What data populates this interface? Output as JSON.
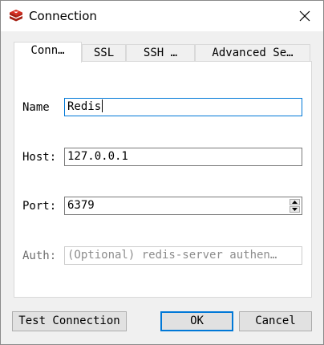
{
  "window": {
    "title": "Connection",
    "icon": "redis-logo-icon",
    "close_icon": "close-icon"
  },
  "tabs": [
    {
      "label": "Conn…",
      "active": true
    },
    {
      "label": "SSL",
      "active": false
    },
    {
      "label": "SSH …",
      "active": false
    },
    {
      "label": "Advanced Se…",
      "active": false
    }
  ],
  "form": {
    "name": {
      "label": "Name",
      "value": "Redis"
    },
    "host": {
      "label": "Host:",
      "value": "127.0.0.1"
    },
    "port": {
      "label": "Port:",
      "value": "6379"
    },
    "auth": {
      "label": "Auth:",
      "value": "",
      "placeholder": "(Optional) redis-server authen…"
    }
  },
  "buttons": {
    "test": "Test Connection",
    "ok": "OK",
    "cancel": "Cancel"
  },
  "colors": {
    "accent": "#0078d7",
    "brand": "#d82c20"
  }
}
